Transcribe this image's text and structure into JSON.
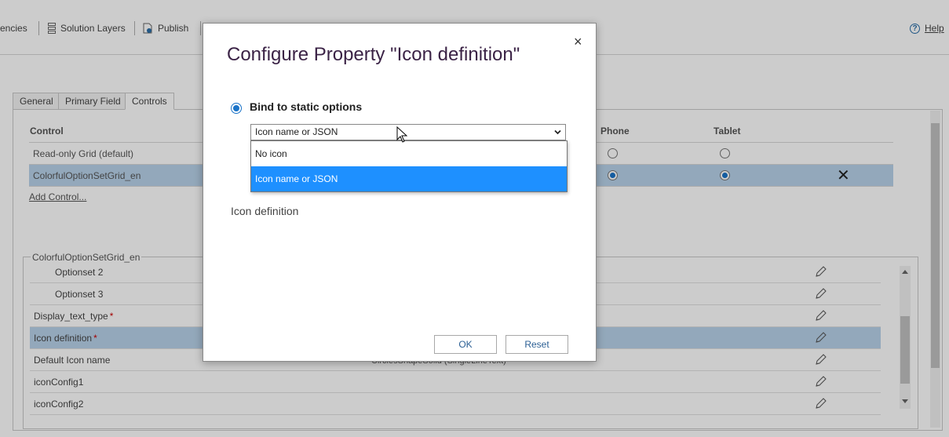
{
  "toolbar": {
    "items": [
      {
        "label": "encies"
      },
      {
        "label": "Solution Layers"
      },
      {
        "label": "Publish"
      }
    ],
    "help_label": "Help",
    "help_glyph": "?"
  },
  "tabs": [
    {
      "label": "General"
    },
    {
      "label": "Primary Field"
    },
    {
      "label": "Controls"
    }
  ],
  "controls_grid": {
    "headers": {
      "control": "Control",
      "phone": "Phone",
      "tablet": "Tablet"
    },
    "rows": [
      {
        "name": "Read-only Grid (default)",
        "phone": false,
        "tablet": false
      },
      {
        "name": "ColorfulOptionSetGrid_en",
        "phone": true,
        "tablet": true
      }
    ],
    "add_control_label": "Add Control...",
    "remove_glyph": "✕"
  },
  "properties": {
    "group_title": "ColorfulOptionSetGrid_en",
    "rows": [
      {
        "name": "Optionset 2",
        "required": false,
        "value": ""
      },
      {
        "name": "Optionset 3",
        "required": false,
        "value": ""
      },
      {
        "name": "Display_text_type",
        "required": true,
        "value": ""
      },
      {
        "name": "Icon definition",
        "required": true,
        "value": ""
      },
      {
        "name": "Default Icon name",
        "required": false,
        "value": "CirclesShapeSolid (SingleLineText)"
      },
      {
        "name": "iconConfig1",
        "required": false,
        "value": ""
      },
      {
        "name": "iconConfig2",
        "required": false,
        "value": ""
      }
    ],
    "required_marker": "*"
  },
  "dialog": {
    "title": "Configure Property \"Icon definition\"",
    "close_glyph": "×",
    "bind_label": "Bind to static options",
    "select_value": "Icon name or JSON",
    "options": [
      {
        "label": "No icon",
        "highlighted": false
      },
      {
        "label": "Icon name or JSON",
        "highlighted": true
      }
    ],
    "property_caption": "Icon definition",
    "ok_label": "OK",
    "reset_label": "Reset"
  },
  "colors": {
    "accent": "#1a73c8",
    "selection_row": "#b8d2ea",
    "dropdown_highlight": "#1e90ff",
    "title_color": "#3b2346"
  }
}
